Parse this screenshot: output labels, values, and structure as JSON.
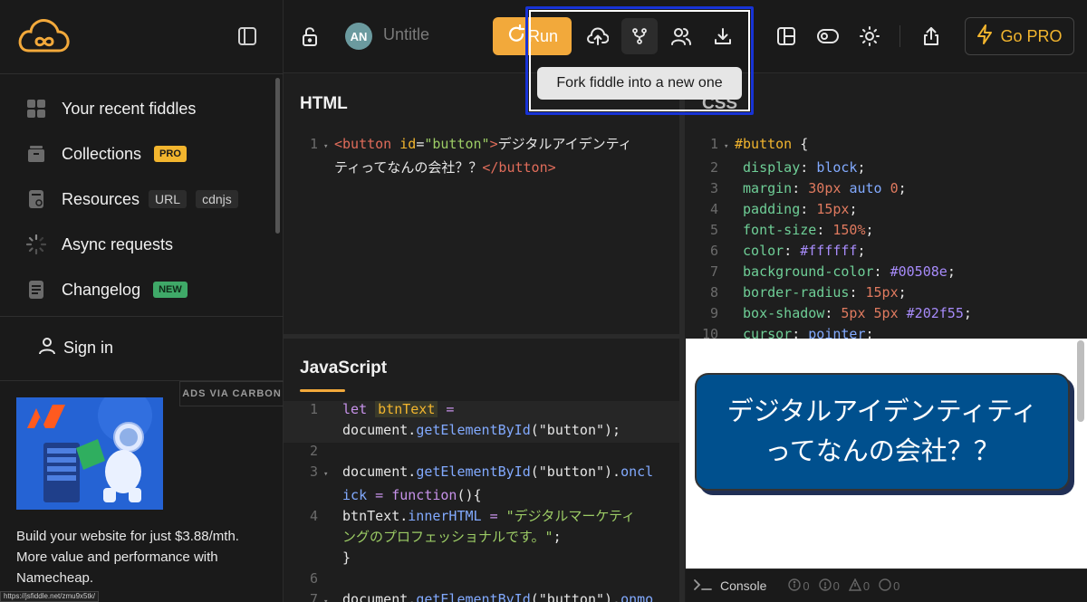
{
  "sidebar": {
    "nav": [
      {
        "label": "Your recent fiddles",
        "icon": "grid-icon"
      },
      {
        "label": "Collections",
        "icon": "box-icon",
        "badge": "PRO"
      },
      {
        "label": "Resources",
        "icon": "file-icon",
        "tags": [
          "URL",
          "cdnjs"
        ]
      },
      {
        "label": "Async requests",
        "icon": "spinner-icon"
      },
      {
        "label": "Changelog",
        "icon": "document-icon",
        "badge": "NEW"
      }
    ],
    "sign_in": "Sign in",
    "ads_label": "ADS VIA CARBON",
    "ad_text": "Build your website for just $3.88/mth. More value and performance with Namecheap.",
    "url_hint": "https://jsfiddle.net/zmu9x5tk/"
  },
  "topbar": {
    "avatar_initials": "AN",
    "title": "Untitle",
    "run_label": "Run",
    "pro_label": "Go PRO",
    "tooltip": "Fork fiddle into a new one"
  },
  "panels": {
    "html_title": "HTML",
    "css_title": "CSS",
    "js_title": "JavaScript"
  },
  "result": {
    "button_text": "デジタルアイデンティティってなんの会社？？"
  },
  "console": {
    "label": "Console",
    "counts": [
      "0",
      "0",
      "0",
      "0"
    ]
  },
  "colors": {
    "accent": "#f2a93b",
    "demo_button": "#00508e",
    "demo_shadow": "#202f55"
  }
}
